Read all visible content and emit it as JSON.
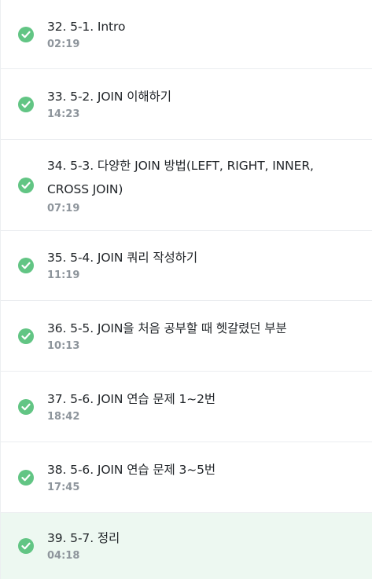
{
  "lessons": [
    {
      "title": "32. 5-1. Intro",
      "duration": "02:19",
      "completed": true,
      "active": false
    },
    {
      "title": "33. 5-2. JOIN 이해하기",
      "duration": "14:23",
      "completed": true,
      "active": false
    },
    {
      "title": "34. 5-3. 다양한 JOIN 방법(LEFT, RIGHT, INNER, CROSS JOIN)",
      "duration": "07:19",
      "completed": true,
      "active": false
    },
    {
      "title": "35. 5-4. JOIN 쿼리 작성하기",
      "duration": "11:19",
      "completed": true,
      "active": false
    },
    {
      "title": "36. 5-5. JOIN을 처음 공부할 때 헷갈렸던 부분",
      "duration": "10:13",
      "completed": true,
      "active": false
    },
    {
      "title": "37. 5-6. JOIN 연습 문제 1~2번",
      "duration": "18:42",
      "completed": true,
      "active": false
    },
    {
      "title": "38. 5-6. JOIN 연습 문제 3~5번",
      "duration": "17:45",
      "completed": true,
      "active": false
    },
    {
      "title": "39. 5-7. 정리",
      "duration": "04:18",
      "completed": true,
      "active": true
    }
  ],
  "colors": {
    "check": "#62c584",
    "active_background": "#edf8f1",
    "title_text": "#212529",
    "duration_text": "#8e959c"
  },
  "icons": {
    "completed": "check-circle-icon"
  }
}
